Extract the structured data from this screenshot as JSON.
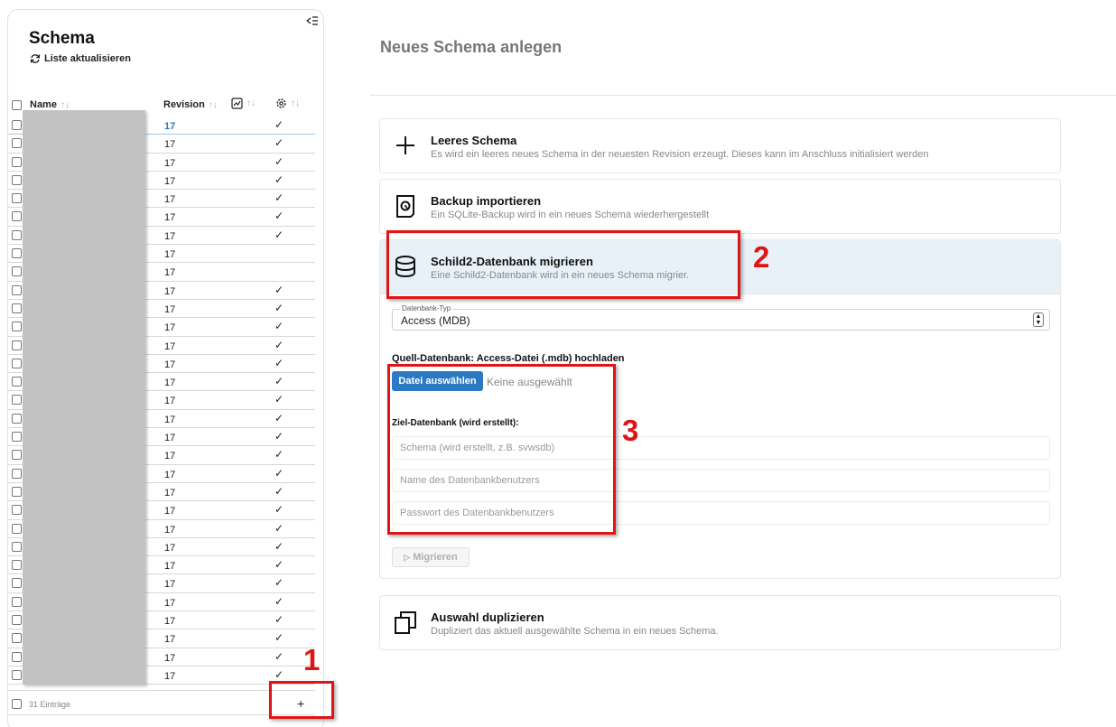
{
  "sidebar": {
    "collapse_icon": "collapse-left-icon",
    "title": "Schema",
    "refresh_label": "Liste aktualisieren",
    "columns": {
      "name": "Name",
      "revision": "Revision",
      "sort": "↑↓"
    },
    "rows": [
      {
        "revision": "17",
        "check": "✓"
      },
      {
        "revision": "17",
        "check": "✓"
      },
      {
        "revision": "17",
        "check": "✓"
      },
      {
        "revision": "17",
        "check": "✓"
      },
      {
        "revision": "17",
        "check": "✓"
      },
      {
        "revision": "17",
        "check": "✓"
      },
      {
        "revision": "17",
        "check": "✓"
      },
      {
        "revision": "17",
        "check": ""
      },
      {
        "revision": "17",
        "check": ""
      },
      {
        "revision": "17",
        "check": "✓"
      },
      {
        "revision": "17",
        "check": "✓"
      },
      {
        "revision": "17",
        "check": "✓"
      },
      {
        "revision": "17",
        "check": "✓"
      },
      {
        "revision": "17",
        "check": "✓"
      },
      {
        "revision": "17",
        "check": "✓"
      },
      {
        "revision": "17",
        "check": "✓"
      },
      {
        "revision": "17",
        "check": "✓"
      },
      {
        "revision": "17",
        "check": "✓"
      },
      {
        "revision": "17",
        "check": "✓"
      },
      {
        "revision": "17",
        "check": "✓"
      },
      {
        "revision": "17",
        "check": "✓"
      },
      {
        "revision": "17",
        "check": "✓"
      },
      {
        "revision": "17",
        "check": "✓"
      },
      {
        "revision": "17",
        "check": "✓"
      },
      {
        "revision": "17",
        "check": "✓"
      },
      {
        "revision": "17",
        "check": "✓"
      },
      {
        "revision": "17",
        "check": "✓"
      },
      {
        "revision": "17",
        "check": "✓"
      },
      {
        "revision": "17",
        "check": "✓"
      },
      {
        "revision": "17",
        "check": "✓"
      },
      {
        "revision": "17",
        "check": "✓"
      }
    ],
    "footer": {
      "count": "31 Einträge",
      "add_label": "+"
    }
  },
  "main": {
    "title": "Neues Schema anlegen",
    "cards": {
      "empty": {
        "title": "Leeres Schema",
        "desc": "Es wird ein leeres neues Schema in der neuesten Revision erzeugt. Dieses kann im Anschluss initialisiert werden"
      },
      "backup": {
        "title": "Backup importieren",
        "desc": "Ein SQLite-Backup wird in ein neues Schema wiederhergestellt"
      },
      "migrate": {
        "title": "Schild2-Datenbank migrieren",
        "desc": "Eine Schild2-Datenbank wird in ein neues Schema migrier.",
        "db_type_label": "Datenbank-Typ",
        "db_type_value": "Access (MDB)",
        "source_label": "Quell-Datenbank: Access-Datei (.mdb) hochladen",
        "file_button": "Datei auswählen",
        "file_status": "Keine ausgewählt",
        "target_label": "Ziel-Datenbank (wird erstellt):",
        "schema_placeholder": "Schema (wird erstellt, z.B. svwsdb)",
        "user_placeholder": "Name des Datenbankbenutzers",
        "password_placeholder": "Passwort des Datenbankbenutzers",
        "migrate_button": "Migrieren",
        "migrate_icon": "▷"
      },
      "duplicate": {
        "title": "Auswahl duplizieren",
        "desc": "Dupliziert das aktuell ausgewählte Schema in ein neues Schema."
      }
    }
  },
  "annotations": {
    "one": "1",
    "two": "2",
    "three": "3",
    "color": "#e01414"
  }
}
